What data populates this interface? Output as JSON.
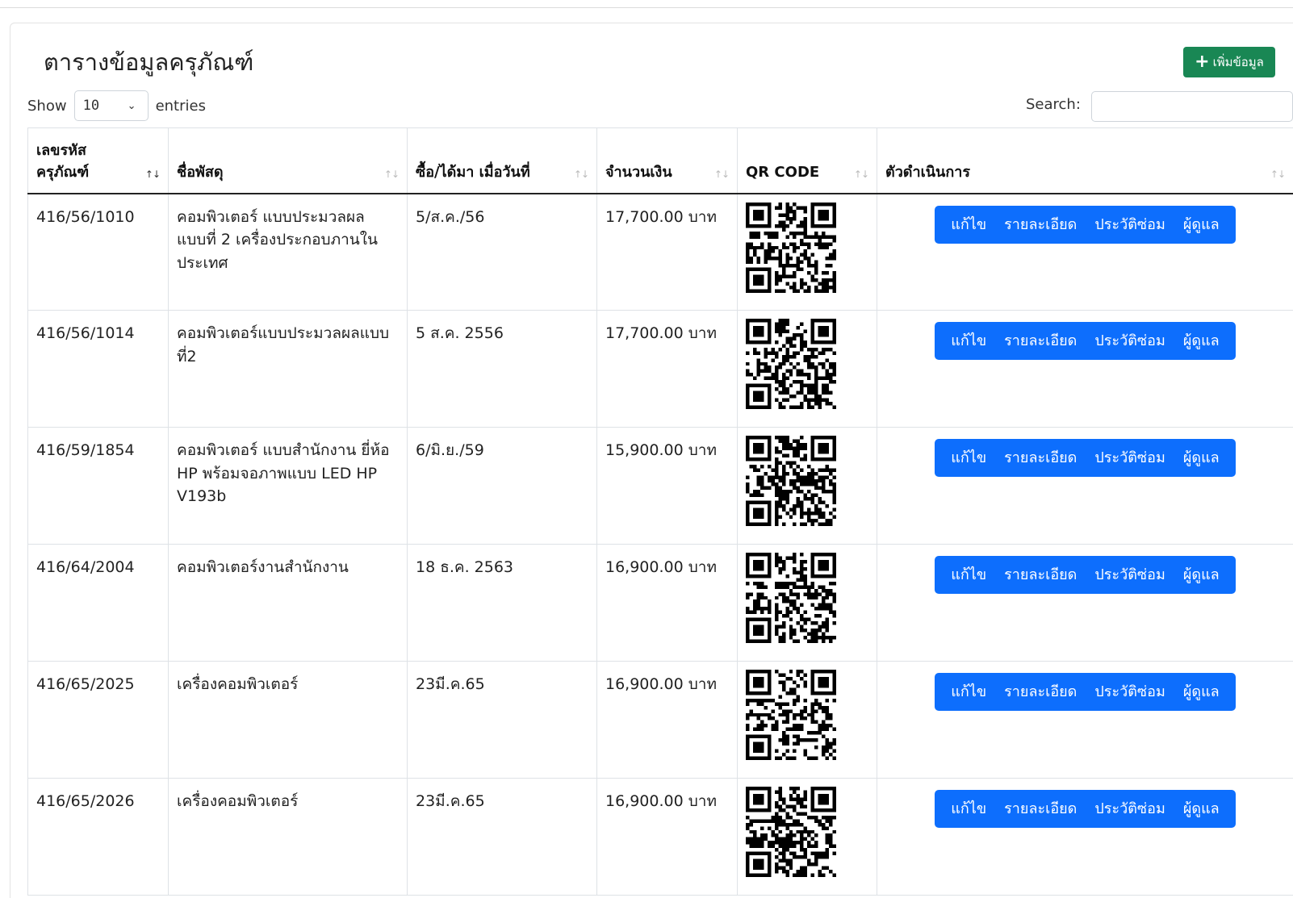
{
  "page": {
    "title": "ตารางข้อมูลครุภัณฑ์",
    "add_button": "เพิ่มข้อมูล",
    "show_label": "Show",
    "entries_value": "10",
    "entries_label": "entries",
    "search_label": "Search:",
    "search_value": ""
  },
  "table": {
    "headers": [
      "เลขรหัส\nครุภัณฑ์",
      "ชื่อพัสดุ",
      "ซื้อ/ได้มา เมื่อวันที่",
      "จำนวนเงิน",
      "QR CODE",
      "ตัวดำเนินการ"
    ],
    "action_labels": [
      "แก้ไข",
      "รายละเอียด",
      "ประวัติซ่อม",
      "ผู้ดูแล"
    ],
    "rows": [
      {
        "code": "416/56/1010",
        "name": "คอมพิวเตอร์ แบบประมวลผล แบบที่ 2 เครื่องประกอบภานในประเทศ",
        "date": "5/ส.ค./56",
        "amount": "17,700.00 บาท"
      },
      {
        "code": "416/56/1014",
        "name": "คอมพิวเตอร์แบบประมวลผลแบบที่2",
        "date": "5 ส.ค. 2556",
        "amount": "17,700.00 บาท"
      },
      {
        "code": "416/59/1854",
        "name": "คอมพิวเตอร์ แบบสำนักงาน ยี่ห้อ HP พร้อมจอภาพแบบ LED HP V193b",
        "date": "6/มิ.ย./59",
        "amount": "15,900.00 บาท"
      },
      {
        "code": "416/64/2004",
        "name": "คอมพิวเตอร์งานสำนักงาน",
        "date": "18 ธ.ค. 2563",
        "amount": "16,900.00 บาท"
      },
      {
        "code": "416/65/2025",
        "name": "เครื่องคอมพิวเตอร์",
        "date": "23มี.ค.65",
        "amount": "16,900.00 บาท"
      },
      {
        "code": "416/65/2026",
        "name": "เครื่องคอมพิวเตอร์",
        "date": "23มี.ค.65",
        "amount": "16,900.00 บาท"
      }
    ]
  },
  "colors": {
    "primary": "#0d6efd",
    "success": "#198754"
  }
}
